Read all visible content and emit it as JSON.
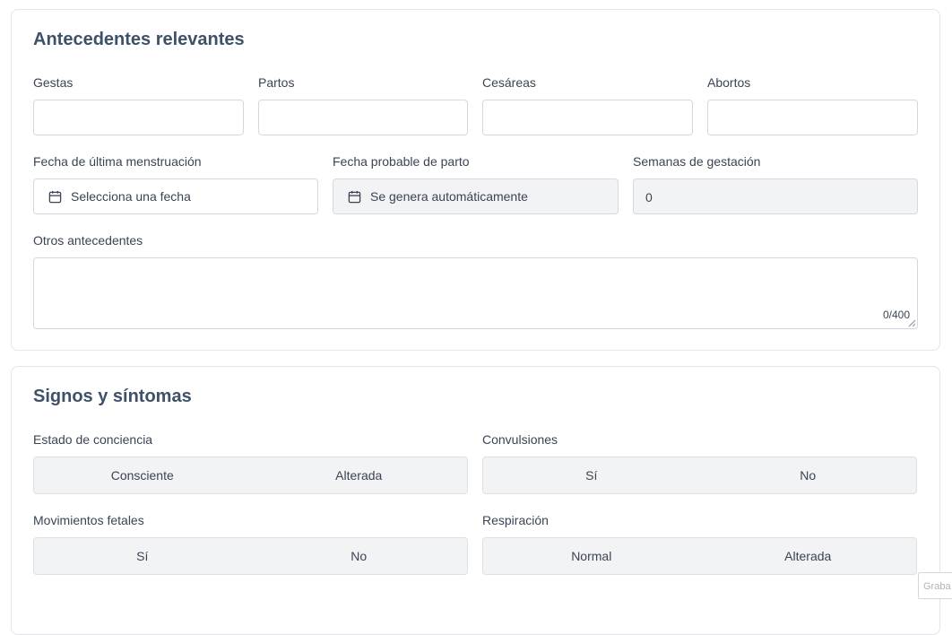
{
  "antecedentes": {
    "title": "Antecedentes relevantes",
    "gestas_label": "Gestas",
    "partos_label": "Partos",
    "cesareas_label": "Cesáreas",
    "abortos_label": "Abortos",
    "fum_label": "Fecha de última menstruación",
    "fum_placeholder": "Selecciona una fecha",
    "fpp_label": "Fecha probable de parto",
    "fpp_value": "Se genera automáticamente",
    "semanas_label": "Semanas de gestación",
    "semanas_value": "0",
    "otros_label": "Otros antecedentes",
    "otros_counter": "0/400"
  },
  "signos": {
    "title": "Signos y síntomas",
    "conciencia": {
      "label": "Estado de conciencia",
      "options": [
        "Consciente",
        "Alterada"
      ]
    },
    "convulsiones": {
      "label": "Convulsiones",
      "options": [
        "Sí",
        "No"
      ]
    },
    "movimientos": {
      "label": "Movimientos fetales",
      "options": [
        "Sí",
        "No"
      ]
    },
    "respiracion": {
      "label": "Respiración",
      "options": [
        "Normal",
        "Alterada"
      ]
    }
  },
  "icons": {
    "calendar": "calendar-icon",
    "resize": "resize-handle-icon"
  },
  "floating_badge": "Graba"
}
